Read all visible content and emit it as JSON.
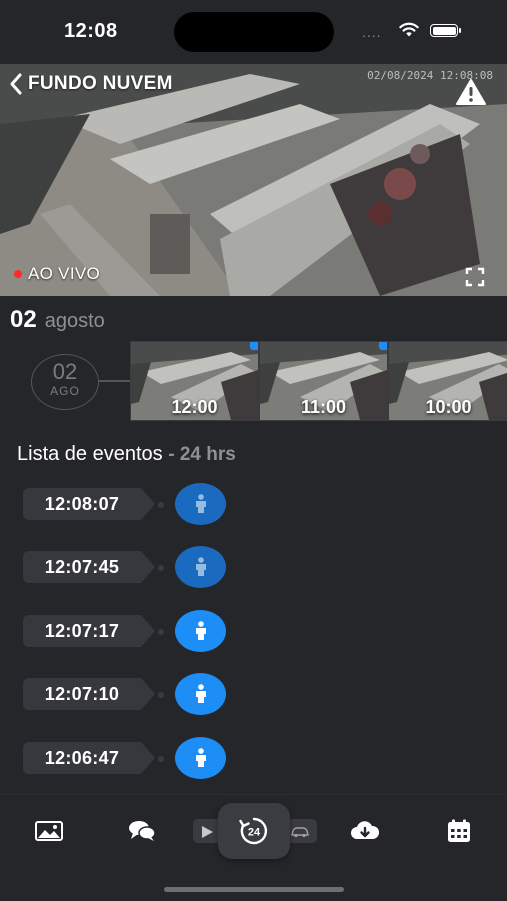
{
  "status_bar": {
    "time": "12:08",
    "signal_dots": "...."
  },
  "header": {
    "title": "FUNDO NUVEM",
    "camera_timestamp": "02/08/2024 12:08:08"
  },
  "video": {
    "live_label": "AO VIVO"
  },
  "date_header": {
    "day": "02",
    "month": "agosto"
  },
  "timeline": {
    "day_marker": {
      "day": "02",
      "month": "AGO"
    },
    "thumbnails": [
      {
        "label": "12:00"
      },
      {
        "label": "11:00"
      },
      {
        "label": "10:00"
      }
    ]
  },
  "events": {
    "title": "Lista de eventos",
    "subtitle": "- 24 hrs",
    "items": [
      {
        "time": "12:08:07",
        "icon": "person-icon",
        "color": "#1a6bbf"
      },
      {
        "time": "12:07:45",
        "icon": "person-icon",
        "color": "#1a6bbf"
      },
      {
        "time": "12:07:17",
        "icon": "person-icon",
        "color": "#1e8ef7"
      },
      {
        "time": "12:07:10",
        "icon": "person-icon",
        "color": "#1e8ef7"
      },
      {
        "time": "12:06:47",
        "icon": "person-icon",
        "color": "#1e8ef7"
      }
    ]
  },
  "bottom_nav": {
    "items": [
      "gallery-icon",
      "chat-icon",
      "play-icon",
      "24h-icon",
      "car-icon",
      "cloud-download-icon",
      "calendar-icon"
    ]
  },
  "colors": {
    "background": "#252629",
    "accent": "#1e8ef7",
    "live": "#ff2a2a"
  }
}
